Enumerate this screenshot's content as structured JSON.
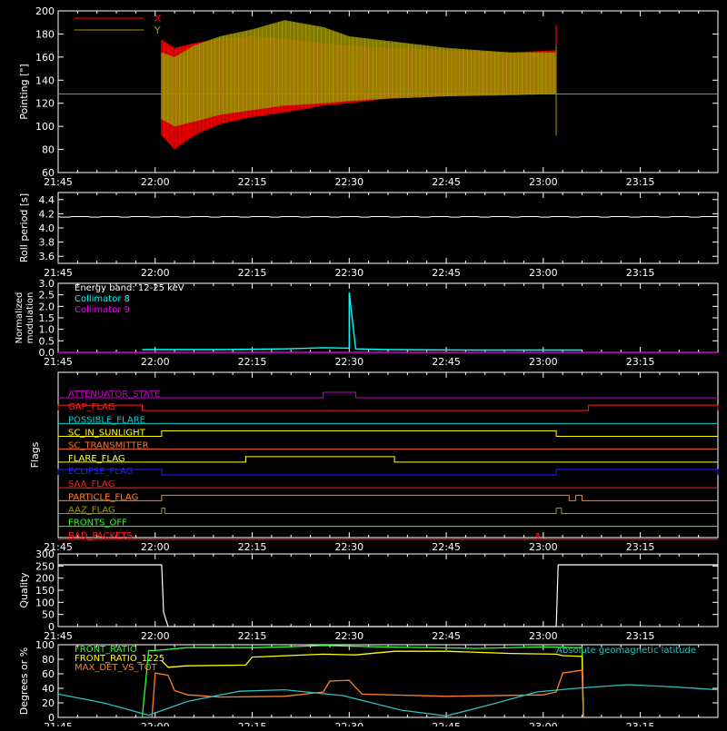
{
  "time_ticks": [
    "21:45",
    "22:00",
    "22:15",
    "22:30",
    "22:45",
    "23:00",
    "23:15"
  ],
  "chart_data": [
    {
      "name": "pointing",
      "type": "line",
      "ylabel": "Pointing [\"]",
      "xlim": [
        "21:45",
        "23:27"
      ],
      "ylim": [
        60,
        200
      ],
      "yticks": [
        60,
        80,
        100,
        120,
        140,
        160,
        180,
        200
      ],
      "legend_placement": "top-left",
      "series": [
        {
          "name": "X",
          "color": "#ff0000",
          "x": [
            "22:01",
            "22:03",
            "22:06",
            "22:10",
            "22:15",
            "22:20",
            "22:26",
            "22:30",
            "22:36",
            "22:45",
            "22:55",
            "23:02"
          ],
          "upper": [
            175,
            168,
            172,
            176,
            178,
            176,
            172,
            170,
            168,
            166,
            164,
            166
          ],
          "lower": [
            92,
            80,
            92,
            102,
            108,
            112,
            118,
            120,
            124,
            126,
            128,
            129
          ]
        },
        {
          "name": "Y",
          "color": "#a09600",
          "x": [
            "22:01",
            "22:03",
            "22:06",
            "22:10",
            "22:15",
            "22:20",
            "22:26",
            "22:30",
            "22:36",
            "22:45",
            "22:55",
            "23:02"
          ],
          "upper": [
            164,
            160,
            170,
            178,
            184,
            192,
            186,
            178,
            174,
            168,
            164,
            164
          ],
          "lower": [
            106,
            100,
            104,
            110,
            114,
            118,
            120,
            122,
            124,
            126,
            127,
            128
          ]
        }
      ],
      "baseline": 128
    },
    {
      "name": "roll",
      "type": "line",
      "ylabel": "Roll period [s]",
      "ylim": [
        3.5,
        4.5
      ],
      "yticks": [
        3.6,
        3.8,
        4.0,
        4.2,
        4.4
      ],
      "series": [
        {
          "name": "",
          "color": "#ffffff",
          "x": [
            "21:45",
            "23:27"
          ],
          "y": [
            4.16,
            4.16
          ]
        }
      ]
    },
    {
      "name": "modulation",
      "type": "line",
      "ylabel": "Normalized modulation",
      "ylim": [
        0,
        3.0
      ],
      "yticks": [
        0.0,
        0.5,
        1.0,
        1.5,
        2.0,
        2.5,
        3.0
      ],
      "legend_placement": "top-left",
      "annotation": "Energy band: 12-25 keV",
      "series": [
        {
          "name": "Collimator 8",
          "color": "#00ffff",
          "x": [
            "21:58",
            "22:10",
            "22:20",
            "22:26",
            "22:30",
            "22:30",
            "22:31",
            "22:36",
            "22:50",
            "23:00",
            "23:06"
          ],
          "y": [
            0.12,
            0.12,
            0.15,
            0.2,
            0.18,
            2.6,
            0.15,
            0.12,
            0.1,
            0.1,
            0.1
          ]
        },
        {
          "name": "Collimator 9",
          "color": "#ff00ff",
          "x": [
            "21:45",
            "23:27"
          ],
          "y": [
            0.0,
            0.0
          ]
        }
      ]
    },
    {
      "name": "flags",
      "type": "line",
      "ylabel": "Flags",
      "flags": [
        {
          "name": "ATTENUATOR_STATE",
          "color": "#cc00cc",
          "on": [
            [
              "22:26",
              "22:31"
            ]
          ]
        },
        {
          "name": "GAP_FLAG",
          "color": "#ff2020",
          "on": [
            [
              "21:45",
              "21:58"
            ],
            [
              "23:07",
              "23:27"
            ]
          ]
        },
        {
          "name": "POSSIBLE_FLARE",
          "color": "#00d0d0",
          "on": []
        },
        {
          "name": "SC_IN_SUNLIGHT",
          "color": "#ffff00",
          "on": [
            [
              "22:01",
              "23:02"
            ]
          ]
        },
        {
          "name": "SC_TRANSMITTER",
          "color": "#ff7020",
          "on": []
        },
        {
          "name": "FLARE_FLAG",
          "color": "#ffff40",
          "on": [
            [
              "22:14",
              "22:37"
            ]
          ]
        },
        {
          "name": "ECLIPSE_FLAG",
          "color": "#2020ff",
          "on": [
            [
              "21:45",
              "22:01"
            ],
            [
              "23:02",
              "23:27"
            ]
          ]
        },
        {
          "name": "SAA_FLAG",
          "color": "#ff2020",
          "on": []
        },
        {
          "name": "PARTICLE_FLAG",
          "color": "#ff8030",
          "on": [
            [
              "22:01",
              "23:04"
            ],
            [
              "23:05",
              "23:06"
            ]
          ]
        },
        {
          "name": "AAZ_FLAG",
          "color": "#a09600",
          "on": [
            [
              "22:01",
              "22:01.5"
            ],
            [
              "23:02",
              "23:02.8"
            ]
          ]
        },
        {
          "name": "FRONTS_OFF",
          "color": "#30ff30",
          "on": []
        },
        {
          "name": "BAD_PACKETS",
          "color": "#ff2020",
          "on": [
            [
              "22:59",
              "22:59.3"
            ]
          ]
        }
      ]
    },
    {
      "name": "quality",
      "type": "line",
      "ylabel": "Quality",
      "ylim": [
        0,
        300
      ],
      "yticks": [
        0,
        50,
        100,
        150,
        200,
        250,
        300
      ],
      "series": [
        {
          "name": "",
          "color": "#ffffff",
          "x": [
            "21:45",
            "22:01",
            "22:01.3",
            "22:02",
            "23:02",
            "23:02.3",
            "23:27"
          ],
          "y": [
            255,
            255,
            60,
            0,
            0,
            255,
            255
          ]
        }
      ]
    },
    {
      "name": "ratios",
      "type": "line",
      "ylabel": "Degrees or %",
      "ylim": [
        0,
        100
      ],
      "yticks": [
        0,
        20,
        40,
        60,
        80,
        100
      ],
      "legend_placement": "top-left",
      "annotation": "Absolute geomagnetic latitude",
      "series": [
        {
          "name": "FRONT_RATIO",
          "color": "#30ff30",
          "x": [
            "21:58",
            "21:59",
            "22:00",
            "22:05",
            "22:15",
            "22:20",
            "22:26",
            "22:35",
            "22:50",
            "23:00",
            "23:06",
            "23:06.2"
          ],
          "y": [
            0,
            92,
            93,
            95,
            96,
            98,
            98,
            97,
            96,
            96,
            96,
            0
          ]
        },
        {
          "name": "FRONT_RATIO_1225",
          "color": "#ffff00",
          "x": [
            "22:01",
            "22:02",
            "22:05",
            "22:14",
            "22:15",
            "22:26",
            "22:31",
            "22:37",
            "22:45",
            "22:55",
            "23:02",
            "23:03",
            "23:06",
            "23:06.2"
          ],
          "y": [
            78,
            70,
            70,
            72,
            84,
            86,
            86,
            92,
            90,
            88,
            88,
            84,
            84,
            0
          ]
        },
        {
          "name": "MAX_DET_VS_TOT",
          "color": "#ff8020",
          "x": [
            "21:59.5",
            "22:00",
            "22:02",
            "22:03",
            "22:05",
            "22:10",
            "22:20",
            "22:26",
            "22:27",
            "22:30",
            "22:31",
            "22:32",
            "22:45",
            "23:00",
            "23:02",
            "23:03",
            "23:06",
            "23:06.2"
          ],
          "y": [
            0,
            60,
            58,
            38,
            30,
            28,
            30,
            34,
            50,
            52,
            40,
            32,
            30,
            30,
            35,
            62,
            64,
            0
          ]
        },
        {
          "name": "Absolute geomagnetic latitude",
          "color": "#30c0c0",
          "x": [
            "21:45",
            "21:52",
            "21:59",
            "22:05",
            "22:13",
            "22:20",
            "22:29",
            "22:38",
            "22:45",
            "22:52",
            "22:59",
            "23:05",
            "23:13",
            "23:20",
            "23:27"
          ],
          "y": [
            32,
            20,
            3,
            22,
            36,
            38,
            30,
            10,
            2,
            18,
            35,
            40,
            45,
            42,
            38
          ]
        }
      ]
    }
  ]
}
